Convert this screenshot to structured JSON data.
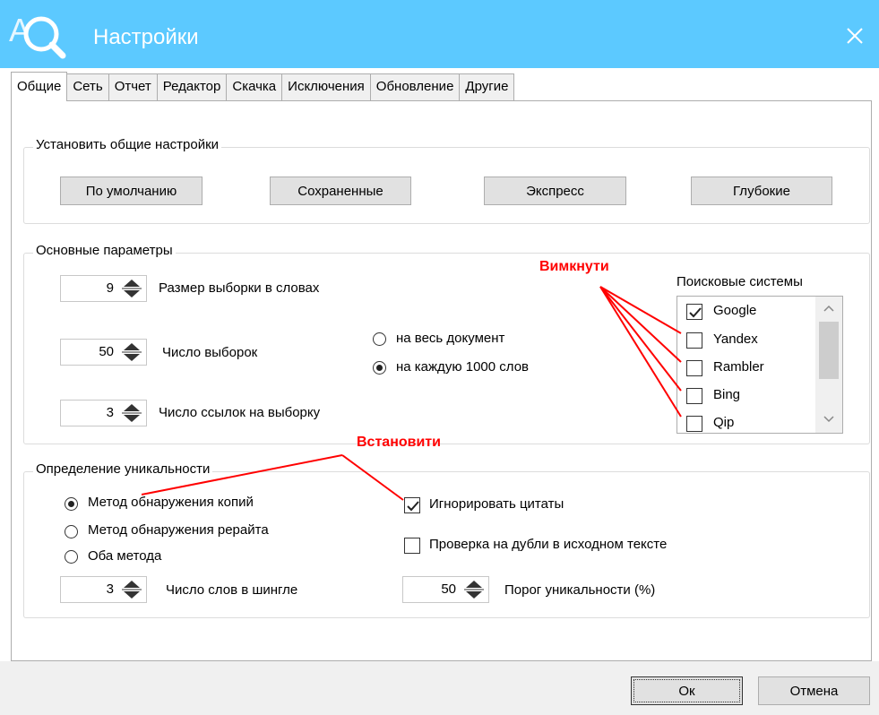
{
  "window": {
    "title": "Настройки",
    "close_icon": "close-icon",
    "app_icon": "magnifier-logo-icon",
    "accent": "#5cc9ff"
  },
  "tabs": [
    {
      "label": "Общие",
      "active": true
    },
    {
      "label": "Сеть",
      "active": false
    },
    {
      "label": "Отчет",
      "active": false
    },
    {
      "label": "Редактор",
      "active": false
    },
    {
      "label": "Скачка",
      "active": false
    },
    {
      "label": "Исключения",
      "active": false
    },
    {
      "label": "Обновление",
      "active": false
    },
    {
      "label": "Другие",
      "active": false
    }
  ],
  "presets": {
    "title": "Установить общие настройки",
    "default_label": "По умолчанию",
    "saved_label": "Сохраненные",
    "express_label": "Экспресс",
    "deep_label": "Глубокие"
  },
  "main_params": {
    "title": "Основные параметры",
    "sample_size": {
      "value": "9",
      "label": "Размер выборки в словах"
    },
    "sample_count": {
      "value": "50",
      "label": "Число выборок"
    },
    "links_per_sample": {
      "value": "3",
      "label": "Число ссылок на выборку"
    },
    "scope_whole_doc": {
      "label": "на весь документ",
      "checked": false
    },
    "scope_per_1000": {
      "label": "на каждую 1000 слов",
      "checked": true
    },
    "search_engines": {
      "title": "Поисковые системы",
      "items": [
        {
          "label": "Google",
          "checked": true
        },
        {
          "label": "Yandex",
          "checked": false
        },
        {
          "label": "Rambler",
          "checked": false
        },
        {
          "label": "Bing",
          "checked": false
        },
        {
          "label": "Qip",
          "checked": false
        }
      ]
    }
  },
  "uniqueness": {
    "title": "Определение уникальности",
    "method_copy": {
      "label": "Метод обнаружения копий",
      "checked": true
    },
    "method_rewrite": {
      "label": "Метод обнаружения рерайта",
      "checked": false
    },
    "method_both": {
      "label": "Оба метода",
      "checked": false
    },
    "ignore_quotes": {
      "label": "Игнорировать цитаты",
      "checked": true
    },
    "check_duplicates": {
      "label": "Проверка на дубли в исходном тексте",
      "checked": false
    },
    "shingle_words": {
      "value": "3",
      "label": "Число слов в шингле"
    },
    "threshold": {
      "value": "50",
      "label": "Порог уникальности (%)"
    }
  },
  "footer": {
    "ok_label": "Ок",
    "cancel_label": "Отмена"
  },
  "annotations": {
    "disable_label": "Вимкнути",
    "enable_label": "Встановити",
    "color": "#ff0000"
  }
}
